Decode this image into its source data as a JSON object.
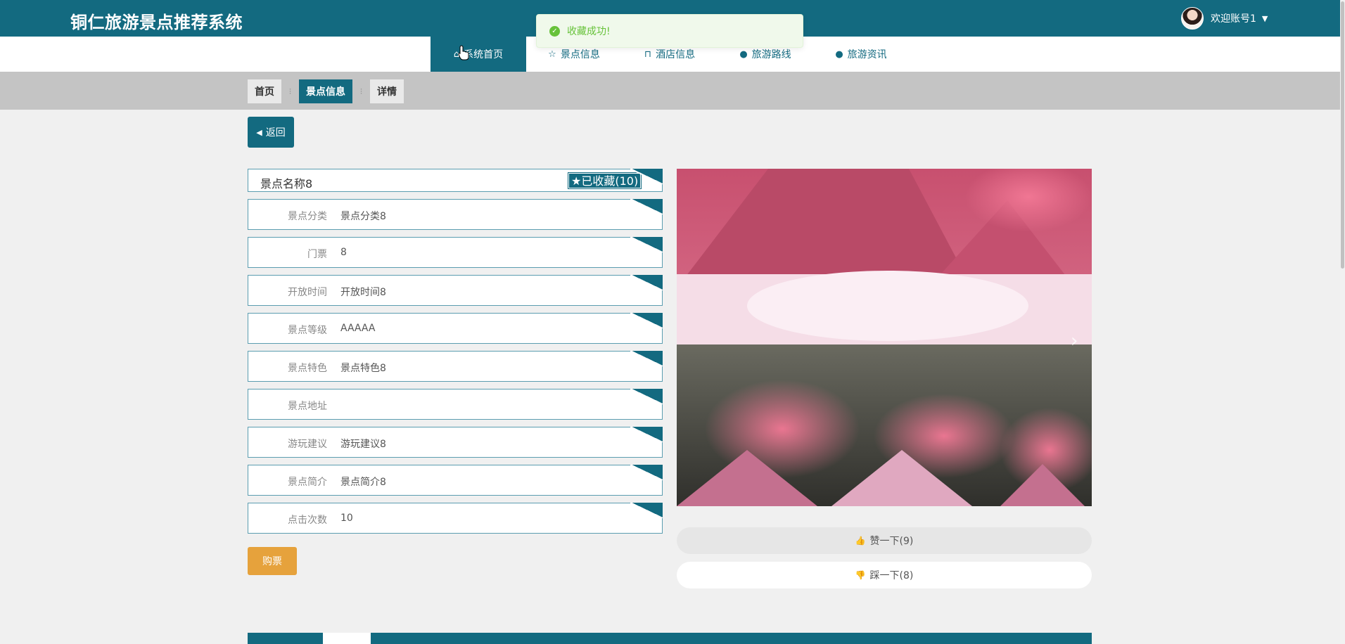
{
  "header": {
    "site_title": "铜仁旅游景点推荐系统",
    "user_label": "欢迎账号1",
    "caret": "▼"
  },
  "nav": {
    "items": [
      {
        "label": "系统首页",
        "icon": "home-icon",
        "glyph": "⌂"
      },
      {
        "label": "景点信息",
        "icon": "star-icon",
        "glyph": "☆"
      },
      {
        "label": "酒店信息",
        "icon": "bag-icon",
        "glyph": "⊓"
      },
      {
        "label": "旅游路线",
        "icon": "exclaim-circle-icon",
        "glyph": "●"
      },
      {
        "label": "旅游资讯",
        "icon": "question-circle-icon",
        "glyph": "●"
      }
    ]
  },
  "breadcrumb": {
    "items": [
      "首页",
      "景点信息",
      "详情"
    ],
    "separator": "⁝"
  },
  "back_button": {
    "label": "返回",
    "glyph": "◀"
  },
  "detail": {
    "name": "景点名称8",
    "collect_label": "★已收藏(10)",
    "rows": [
      {
        "label": "景点分类",
        "value": "景点分类8"
      },
      {
        "label": "门票",
        "value": "8"
      },
      {
        "label": "开放时间",
        "value": "开放时间8"
      },
      {
        "label": "景点等级",
        "value": "AAAAA"
      },
      {
        "label": "景点特色",
        "value": "景点特色8"
      },
      {
        "label": "景点地址",
        "value": ""
      },
      {
        "label": "游玩建议",
        "value": "游玩建议8"
      },
      {
        "label": "景点简介",
        "value": "景点简介8"
      },
      {
        "label": "点击次数",
        "value": "10"
      }
    ]
  },
  "buy_button": {
    "label": "购票"
  },
  "carousel": {
    "next_glyph": "›"
  },
  "votes": {
    "like_label": "赞一下(9)",
    "like_glyph": "👍",
    "dislike_label": "踩一下(8)",
    "dislike_glyph": "👎"
  },
  "toast": {
    "message": "收藏成功!",
    "glyph": "✓"
  },
  "colors": {
    "primary": "#136a80",
    "buy": "#e6a23c",
    "success": "#67c23a"
  }
}
